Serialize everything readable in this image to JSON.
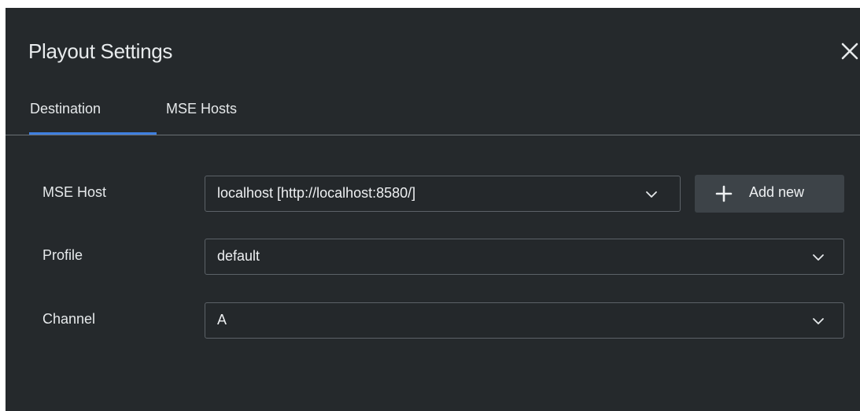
{
  "dialog": {
    "title": "Playout Settings",
    "close_icon": "close-icon"
  },
  "tabs": [
    {
      "label": "Destination",
      "active": true
    },
    {
      "label": "MSE Hosts",
      "active": false
    }
  ],
  "form": {
    "mse_host": {
      "label": "MSE Host",
      "value": "localhost [http://localhost:8580/]"
    },
    "add_new": {
      "label": "Add new",
      "icon": "plus-icon"
    },
    "profile": {
      "label": "Profile",
      "value": "default"
    },
    "channel": {
      "label": "Channel",
      "value": "A"
    }
  },
  "colors": {
    "background": "#25292c",
    "accent": "#3f7fe0",
    "text": "#e6e9eb",
    "field_border": "#5c6268",
    "button_bg": "#3d4348"
  }
}
